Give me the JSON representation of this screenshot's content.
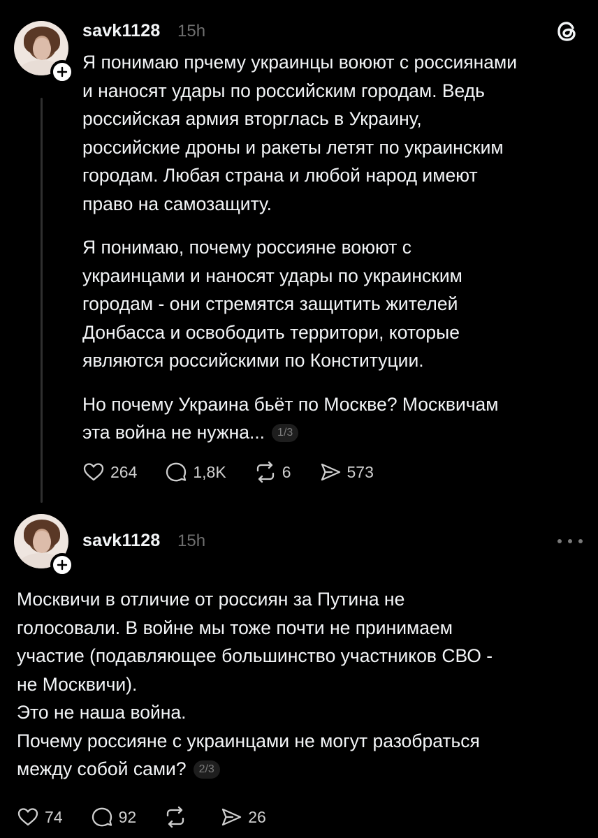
{
  "colors": {
    "background": "#000000",
    "text": "#f3f5f7",
    "muted": "#6f6f6f",
    "thread_line": "#2f2f2f"
  },
  "posts": [
    {
      "username": "savk1128",
      "time": "15h",
      "paragraphs": [
        [
          "Я понимаю прчему украинцы воюют с россиянами",
          "и наносят удары по российским городам. Ведь",
          "российская армия вторглась в Украину,",
          "российские дроны и ракеты летят по украинским",
          "городам. Любая страна и любой народ имеют",
          "право на самозащиту."
        ],
        [
          "Я понимаю, почему россияне воюют с",
          "украинцами и наносят удары по украинским",
          "городам - они стремятся защитить жителей",
          "Донбасса и освободить территори, которые",
          "являются российскими по Конституции."
        ],
        [
          "Но почему Украина бьёт по Москве? Москвичам",
          "эта война не нужна..."
        ]
      ],
      "counter": "1/3",
      "likes": "264",
      "comments": "1,8K",
      "reposts": "6",
      "shares": "573"
    },
    {
      "username": "savk1128",
      "time": "15h",
      "lines": [
        "Москвичи в отличие от россиян за Путина не",
        "голосовали. В войне мы тоже почти не принимаем",
        "участие (подавляющее большинство участников СВО -",
        "не Москвичи).",
        "Это не наша война.",
        "Почему россияне с украинцами не могут разобраться",
        "между собой сами?"
      ],
      "counter": "2/3",
      "likes": "74",
      "comments": "92",
      "reposts": "",
      "shares": "26"
    }
  ],
  "icons": {
    "logo": "threads-logo-icon",
    "more": "more-dots-icon",
    "like": "heart-icon",
    "comment": "comment-bubble-icon",
    "repost": "repost-icon",
    "share": "send-icon",
    "follow": "plus-icon"
  }
}
